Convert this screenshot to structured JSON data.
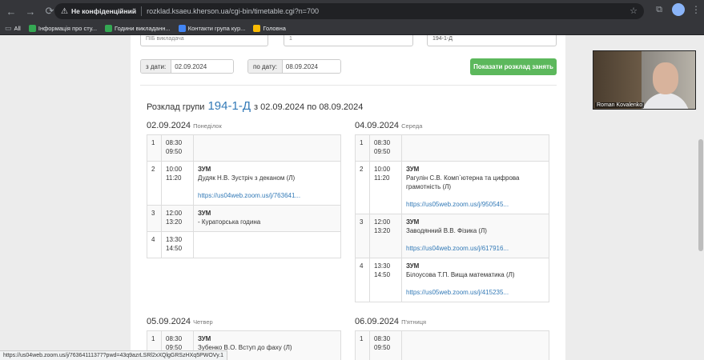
{
  "browser": {
    "security_label": "Не конфіденційний",
    "url": "rozklad.ksaeu.kherson.ua/cgi-bin/timetable.cgi?n=700",
    "bookmarks": [
      {
        "label": "All",
        "color": "#9aa0a6"
      },
      {
        "label": "Інформація про сту...",
        "color": "#34a853"
      },
      {
        "label": "Години викладанн...",
        "color": "#34a853"
      },
      {
        "label": "Контакти група кур...",
        "color": "#4285f4"
      },
      {
        "label": "Головна",
        "color": "#fbbc04"
      }
    ],
    "status_url": "https://us04web.zoom.us/j/76364111377?pwd=43q9azrLSRl2xXQlgGRSzHXq5PWOVy.1"
  },
  "filters": {
    "teacher_placeholder": "ПІБ викладача",
    "middle_select": "1",
    "group_value": "194-1-Д",
    "from_label": "з дати:",
    "from_value": "02.09.2024",
    "to_label": "по дату:",
    "to_value": "08.09.2024",
    "show_button": "Показати розклад занять"
  },
  "heading": {
    "prefix": "Розклад групи",
    "group": "194-1-Д",
    "range": "з 02.09.2024 по 08.09.2024"
  },
  "days": [
    {
      "date": "02.09.2024",
      "dow": "Понеділок",
      "rows": [
        {
          "num": "1",
          "start": "08:30",
          "end": "09:50",
          "title": "",
          "desc": "",
          "link": ""
        },
        {
          "num": "2",
          "start": "10:00",
          "end": "11:20",
          "title": "ЗУМ",
          "desc": "Дудяк Н.В. Зустріч з деканом (Л)",
          "link": "https://us04web.zoom.us/j/763641..."
        },
        {
          "num": "3",
          "start": "12:00",
          "end": "13:20",
          "title": "ЗУМ",
          "desc": "- Кураторська година",
          "link": ""
        },
        {
          "num": "4",
          "start": "13:30",
          "end": "14:50",
          "title": "",
          "desc": "",
          "link": ""
        }
      ]
    },
    {
      "date": "04.09.2024",
      "dow": "Середа",
      "rows": [
        {
          "num": "1",
          "start": "08:30",
          "end": "09:50",
          "title": "",
          "desc": "",
          "link": ""
        },
        {
          "num": "2",
          "start": "10:00",
          "end": "11:20",
          "title": "ЗУМ",
          "desc": "Рагулін С.В. Комп`ютерна та цифрова грамотність (Л)",
          "link": "https://us05web.zoom.us/j/950545..."
        },
        {
          "num": "3",
          "start": "12:00",
          "end": "13:20",
          "title": "ЗУМ",
          "desc": "Заводянний В.В. Фізика (Л)",
          "link": "https://us04web.zoom.us/j/617916..."
        },
        {
          "num": "4",
          "start": "13:30",
          "end": "14:50",
          "title": "ЗУМ",
          "desc": "Білоусова Т.П. Вища математика (Л)",
          "link": "https://us05web.zoom.us/j/415235..."
        }
      ]
    },
    {
      "date": "05.09.2024",
      "dow": "Четвер",
      "rows": [
        {
          "num": "1",
          "start": "08:30",
          "end": "09:50",
          "title": "ЗУМ",
          "desc": "Зубенко В.О. Вступ до фаху (Л)",
          "link": ""
        }
      ]
    },
    {
      "date": "06.09.2024",
      "dow": "П'ятниця",
      "rows": [
        {
          "num": "1",
          "start": "08:30",
          "end": "09:50",
          "title": "",
          "desc": "",
          "link": ""
        }
      ]
    }
  ],
  "video": {
    "name": "Roman Kovalenko"
  }
}
